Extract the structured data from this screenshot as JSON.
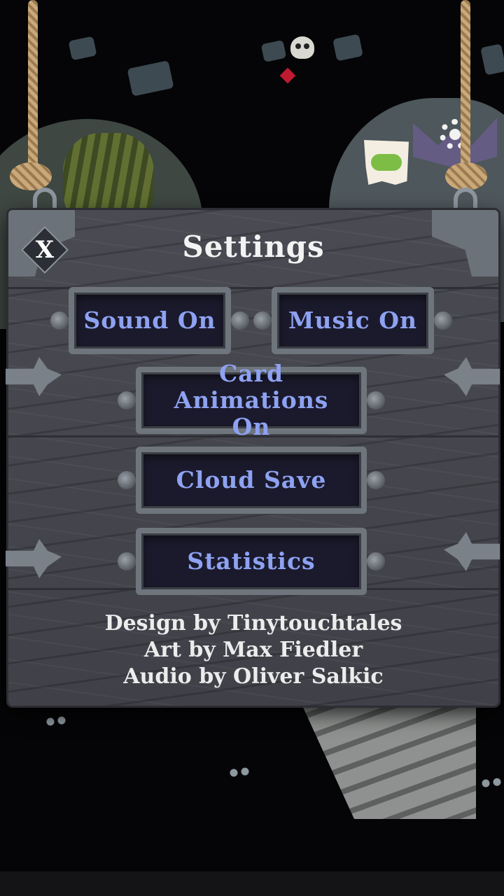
{
  "screen": {
    "title": "Settings",
    "close_label": "X"
  },
  "buttons": {
    "sound": "Sound On",
    "music": "Music On",
    "card_animations": "Card Animations On",
    "cloud_save": "Cloud Save",
    "statistics": "Statistics"
  },
  "credits": {
    "design": "Design by Tinytouchtales",
    "art": "Art by Max Fiedler",
    "audio": "Audio by Oliver Salkic"
  },
  "icons": {
    "close": "close-icon",
    "gamepad": "gamepad-icon",
    "settings": "gear-icon",
    "skull": "skull-icon"
  },
  "colors": {
    "board": "#45464d",
    "button_text": "#8ea2f2",
    "title_text": "#f3f3f3"
  }
}
